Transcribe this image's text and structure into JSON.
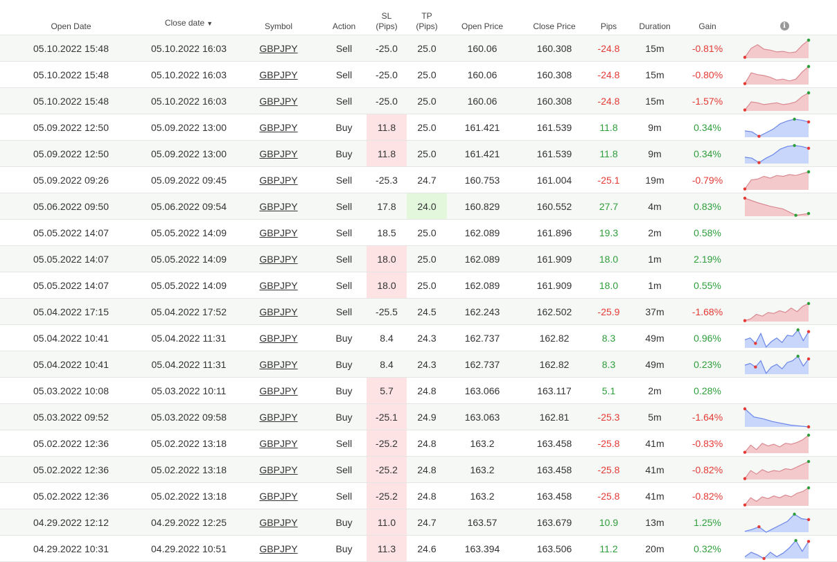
{
  "headers": {
    "open_date": "Open Date",
    "close_date": "Close date",
    "close_date_sort": "▼",
    "symbol": "Symbol",
    "action": "Action",
    "sl": "SL",
    "sl_unit": "(Pips)",
    "tp": "TP",
    "tp_unit": "(Pips)",
    "open_price": "Open Price",
    "close_price": "Close Price",
    "pips": "Pips",
    "duration": "Duration",
    "gain": "Gain",
    "info_icon": "info-icon"
  },
  "colors": {
    "negative": "#e53935",
    "positive": "#2e9e3a",
    "sell_fill": "#f4c9cc",
    "buy_fill": "#c8d6fb",
    "sl_highlight": "#fde3e3",
    "tp_highlight": "#e2f7dc"
  },
  "rows": [
    {
      "open": "05.10.2022 15:48",
      "close": "05.10.2022 16:03",
      "symbol": "GBPJPY",
      "action": "Sell",
      "sl": "-25.0",
      "tp": "25.0",
      "open_price": "160.06",
      "close_price": "160.308",
      "pips": "-24.8",
      "duration": "15m",
      "gain": "-0.81%",
      "sl_hl": false,
      "tp_hl": false,
      "spark": {
        "kind": "sell",
        "pts": [
          0.05,
          0.55,
          0.75,
          0.5,
          0.45,
          0.35,
          0.38,
          0.3,
          0.35,
          0.72,
          1.0
        ],
        "min": 0,
        "max": 10
      }
    },
    {
      "open": "05.10.2022 15:48",
      "close": "05.10.2022 16:03",
      "symbol": "GBPJPY",
      "action": "Sell",
      "sl": "-25.0",
      "tp": "25.0",
      "open_price": "160.06",
      "close_price": "160.308",
      "pips": "-24.8",
      "duration": "15m",
      "gain": "-0.80%",
      "sl_hl": false,
      "tp_hl": false,
      "spark": {
        "kind": "sell",
        "pts": [
          0.05,
          0.65,
          0.55,
          0.5,
          0.4,
          0.25,
          0.3,
          0.2,
          0.3,
          0.7,
          1.0
        ],
        "min": 0,
        "max": 10
      }
    },
    {
      "open": "05.10.2022 15:48",
      "close": "05.10.2022 16:03",
      "symbol": "GBPJPY",
      "action": "Sell",
      "sl": "-25.0",
      "tp": "25.0",
      "open_price": "160.06",
      "close_price": "160.308",
      "pips": "-24.8",
      "duration": "15m",
      "gain": "-1.57%",
      "sl_hl": false,
      "tp_hl": false,
      "spark": {
        "kind": "sell",
        "pts": [
          0.05,
          0.5,
          0.45,
          0.35,
          0.4,
          0.45,
          0.35,
          0.4,
          0.5,
          0.8,
          1.0
        ],
        "min": 0,
        "max": 10
      }
    },
    {
      "open": "05.09.2022 12:50",
      "close": "05.09.2022 13:00",
      "symbol": "GBPJPY",
      "action": "Buy",
      "sl": "11.8",
      "tp": "25.0",
      "open_price": "161.421",
      "close_price": "161.539",
      "pips": "11.8",
      "duration": "9m",
      "gain": "0.34%",
      "sl_hl": true,
      "tp_hl": false,
      "spark": {
        "kind": "buy",
        "pts": [
          0.35,
          0.3,
          0.05,
          0.25,
          0.45,
          0.75,
          0.9,
          1.0,
          0.95,
          0.85
        ],
        "min": 2,
        "max": 7
      }
    },
    {
      "open": "05.09.2022 12:50",
      "close": "05.09.2022 13:00",
      "symbol": "GBPJPY",
      "action": "Buy",
      "sl": "11.8",
      "tp": "25.0",
      "open_price": "161.421",
      "close_price": "161.539",
      "pips": "11.8",
      "duration": "9m",
      "gain": "0.34%",
      "sl_hl": true,
      "tp_hl": false,
      "spark": {
        "kind": "buy",
        "pts": [
          0.35,
          0.3,
          0.05,
          0.3,
          0.5,
          0.8,
          0.95,
          1.0,
          0.95,
          0.85
        ],
        "min": 2,
        "max": 7
      }
    },
    {
      "open": "05.09.2022 09:26",
      "close": "05.09.2022 09:45",
      "symbol": "GBPJPY",
      "action": "Sell",
      "sl": "-25.3",
      "tp": "24.7",
      "open_price": "160.753",
      "close_price": "161.004",
      "pips": "-25.1",
      "duration": "19m",
      "gain": "-0.79%",
      "sl_hl": false,
      "tp_hl": false,
      "spark": {
        "kind": "sell",
        "pts": [
          0.05,
          0.55,
          0.6,
          0.75,
          0.65,
          0.8,
          0.75,
          0.85,
          0.8,
          0.9,
          1.0
        ],
        "min": 0,
        "max": 10
      }
    },
    {
      "open": "05.06.2022 09:50",
      "close": "05.06.2022 09:54",
      "symbol": "GBPJPY",
      "action": "Sell",
      "sl": "17.8",
      "tp": "24.0",
      "open_price": "160.829",
      "close_price": "160.552",
      "pips": "27.7",
      "duration": "4m",
      "gain": "0.83%",
      "sl_hl": false,
      "tp_hl": true,
      "spark": {
        "kind": "sell",
        "pts": [
          1.0,
          0.75,
          0.55,
          0.4,
          0.05,
          0.15
        ],
        "min": 0,
        "max": 4
      }
    },
    {
      "open": "05.05.2022 14:07",
      "close": "05.05.2022 14:09",
      "symbol": "GBPJPY",
      "action": "Sell",
      "sl": "18.5",
      "tp": "25.0",
      "open_price": "162.089",
      "close_price": "161.896",
      "pips": "19.3",
      "duration": "2m",
      "gain": "0.58%",
      "sl_hl": false,
      "tp_hl": false,
      "spark": null
    },
    {
      "open": "05.05.2022 14:07",
      "close": "05.05.2022 14:09",
      "symbol": "GBPJPY",
      "action": "Sell",
      "sl": "18.0",
      "tp": "25.0",
      "open_price": "162.089",
      "close_price": "161.909",
      "pips": "18.0",
      "duration": "1m",
      "gain": "2.19%",
      "sl_hl": true,
      "tp_hl": false,
      "spark": null
    },
    {
      "open": "05.05.2022 14:07",
      "close": "05.05.2022 14:09",
      "symbol": "GBPJPY",
      "action": "Sell",
      "sl": "18.0",
      "tp": "25.0",
      "open_price": "162.089",
      "close_price": "161.909",
      "pips": "18.0",
      "duration": "1m",
      "gain": "0.55%",
      "sl_hl": true,
      "tp_hl": false,
      "spark": null
    },
    {
      "open": "05.04.2022 17:15",
      "close": "05.04.2022 17:52",
      "symbol": "GBPJPY",
      "action": "Sell",
      "sl": "-25.5",
      "tp": "24.5",
      "open_price": "162.243",
      "close_price": "162.502",
      "pips": "-25.9",
      "duration": "37m",
      "gain": "-1.68%",
      "sl_hl": false,
      "tp_hl": false,
      "spark": {
        "kind": "sell",
        "pts": [
          0.05,
          0.15,
          0.4,
          0.3,
          0.5,
          0.45,
          0.6,
          0.5,
          0.75,
          0.55,
          0.85,
          1.0
        ],
        "min": 0,
        "max": 12
      }
    },
    {
      "open": "05.04.2022 10:41",
      "close": "05.04.2022 11:31",
      "symbol": "GBPJPY",
      "action": "Buy",
      "sl": "8.4",
      "tp": "24.3",
      "open_price": "162.737",
      "close_price": "162.82",
      "pips": "8.3",
      "duration": "49m",
      "gain": "0.96%",
      "sl_hl": false,
      "tp_hl": false,
      "spark": {
        "kind": "buy",
        "pts": [
          0.45,
          0.55,
          0.25,
          0.8,
          0.05,
          0.35,
          0.55,
          0.3,
          0.7,
          0.65,
          1.0,
          0.4,
          0.9
        ],
        "min": 2,
        "max": 10
      }
    },
    {
      "open": "05.04.2022 10:41",
      "close": "05.04.2022 11:31",
      "symbol": "GBPJPY",
      "action": "Buy",
      "sl": "8.4",
      "tp": "24.3",
      "open_price": "162.737",
      "close_price": "162.82",
      "pips": "8.3",
      "duration": "49m",
      "gain": "0.23%",
      "sl_hl": false,
      "tp_hl": false,
      "spark": {
        "kind": "buy",
        "pts": [
          0.5,
          0.6,
          0.4,
          0.75,
          0.05,
          0.4,
          0.55,
          0.3,
          0.65,
          0.75,
          1.0,
          0.45,
          0.85
        ],
        "min": 2,
        "max": 10
      }
    },
    {
      "open": "05.03.2022 10:08",
      "close": "05.03.2022 10:11",
      "symbol": "GBPJPY",
      "action": "Buy",
      "sl": "5.7",
      "tp": "24.8",
      "open_price": "163.066",
      "close_price": "163.117",
      "pips": "5.1",
      "duration": "2m",
      "gain": "0.28%",
      "sl_hl": true,
      "tp_hl": false,
      "spark": null
    },
    {
      "open": "05.03.2022 09:52",
      "close": "05.03.2022 09:58",
      "symbol": "GBPJPY",
      "action": "Buy",
      "sl": "-25.1",
      "tp": "24.9",
      "open_price": "163.063",
      "close_price": "162.81",
      "pips": "-25.3",
      "duration": "5m",
      "gain": "-1.64%",
      "sl_hl": true,
      "tp_hl": false,
      "spark": {
        "kind": "buy",
        "pts": [
          1.0,
          0.55,
          0.45,
          0.3,
          0.2,
          0.1,
          0.05,
          0.0
        ],
        "min": 0,
        "max": 7
      }
    },
    {
      "open": "05.02.2022 12:36",
      "close": "05.02.2022 13:18",
      "symbol": "GBPJPY",
      "action": "Sell",
      "sl": "-25.2",
      "tp": "24.8",
      "open_price": "163.2",
      "close_price": "163.458",
      "pips": "-25.8",
      "duration": "41m",
      "gain": "-0.83%",
      "sl_hl": true,
      "tp_hl": false,
      "spark": {
        "kind": "sell",
        "pts": [
          0.05,
          0.45,
          0.2,
          0.55,
          0.4,
          0.5,
          0.35,
          0.55,
          0.5,
          0.6,
          0.75,
          1.0
        ],
        "min": 0,
        "max": 12
      }
    },
    {
      "open": "05.02.2022 12:36",
      "close": "05.02.2022 13:18",
      "symbol": "GBPJPY",
      "action": "Sell",
      "sl": "-25.2",
      "tp": "24.8",
      "open_price": "163.2",
      "close_price": "163.458",
      "pips": "-25.8",
      "duration": "41m",
      "gain": "-0.82%",
      "sl_hl": true,
      "tp_hl": false,
      "spark": {
        "kind": "sell",
        "pts": [
          0.05,
          0.5,
          0.3,
          0.55,
          0.4,
          0.5,
          0.45,
          0.6,
          0.55,
          0.7,
          0.85,
          1.0
        ],
        "min": 0,
        "max": 12
      }
    },
    {
      "open": "05.02.2022 12:36",
      "close": "05.02.2022 13:18",
      "symbol": "GBPJPY",
      "action": "Sell",
      "sl": "-25.2",
      "tp": "24.8",
      "open_price": "163.2",
      "close_price": "163.458",
      "pips": "-25.8",
      "duration": "41m",
      "gain": "-0.82%",
      "sl_hl": true,
      "tp_hl": false,
      "spark": {
        "kind": "sell",
        "pts": [
          0.05,
          0.45,
          0.25,
          0.5,
          0.4,
          0.55,
          0.45,
          0.6,
          0.5,
          0.7,
          0.8,
          1.0
        ],
        "min": 0,
        "max": 12
      }
    },
    {
      "open": "04.29.2022 12:12",
      "close": "04.29.2022 12:25",
      "symbol": "GBPJPY",
      "action": "Buy",
      "sl": "11.0",
      "tp": "24.7",
      "open_price": "163.57",
      "close_price": "163.679",
      "pips": "10.9",
      "duration": "13m",
      "gain": "1.25%",
      "sl_hl": true,
      "tp_hl": false,
      "spark": {
        "kind": "buy",
        "pts": [
          0.05,
          0.15,
          0.3,
          0.0,
          0.2,
          0.4,
          0.6,
          1.0,
          0.75,
          0.7
        ],
        "min": 2,
        "max": 7
      }
    },
    {
      "open": "04.29.2022 10:31",
      "close": "04.29.2022 10:51",
      "symbol": "GBPJPY",
      "action": "Buy",
      "sl": "11.3",
      "tp": "24.6",
      "open_price": "163.394",
      "close_price": "163.506",
      "pips": "11.2",
      "duration": "20m",
      "gain": "0.32%",
      "sl_hl": true,
      "tp_hl": false,
      "spark": {
        "kind": "buy",
        "pts": [
          0.1,
          0.35,
          0.2,
          0.0,
          0.35,
          0.1,
          0.3,
          0.6,
          1.0,
          0.4,
          0.95
        ],
        "min": 3,
        "max": 8
      }
    }
  ]
}
